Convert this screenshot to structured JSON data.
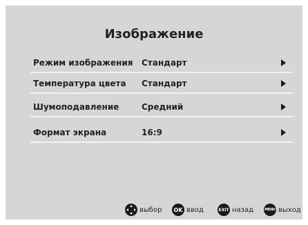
{
  "menu": {
    "title": "Изображение",
    "items": [
      {
        "label": "Режим изображения",
        "value": "Стандарт"
      },
      {
        "label": "Температура цвета",
        "value": "Стандарт"
      },
      {
        "label": "Шумоподавление",
        "value": "Средний"
      },
      {
        "label": "Формат экрана",
        "value": "16:9"
      }
    ]
  },
  "legend": {
    "select_label": "выбор",
    "enter_icon": "OK",
    "enter_label": "ввод",
    "back_icon": "EXIT",
    "back_label": "назад",
    "exit_icon": "MENU",
    "exit_label": "выход"
  },
  "colors": {
    "panel": "#d6d6d6",
    "separator": "#f2f2f2",
    "text": "#222222",
    "icon": "#1a1a1a"
  }
}
